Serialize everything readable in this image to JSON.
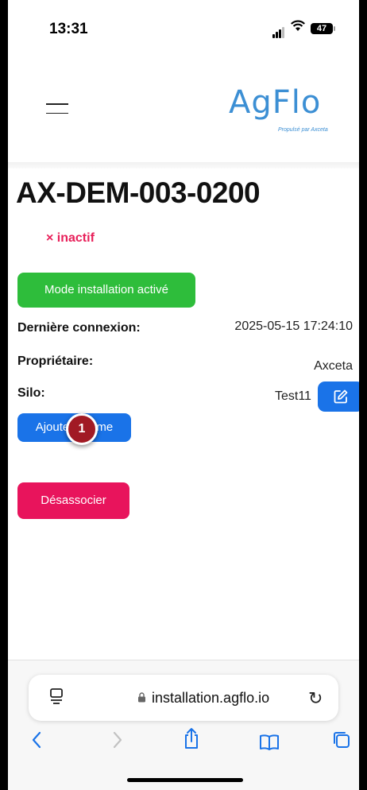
{
  "status_bar": {
    "time": "13:31",
    "battery": "47"
  },
  "header": {
    "logo_text": "AgFlo",
    "logo_subtitle": "Propulsé par Axceta"
  },
  "device": {
    "title": "AX-DEM-003-0200",
    "status": "× inactif",
    "install_mode_button": "Mode installation activé",
    "last_connection_label": "Dernière connexion:",
    "last_connection_value": "2025-05-15 17:24:10",
    "owner_label": "Propriétaire:",
    "owner_value": "Axceta",
    "silo_label": "Silo:",
    "silo_value": "Test11",
    "add_button": "Ajouter alarme",
    "dissociate_button": "Désassocier"
  },
  "marker": {
    "number": "1"
  },
  "browser": {
    "url": "installation.agflo.io"
  },
  "colors": {
    "accent_blue": "#1a73e8",
    "green": "#2ebd3b",
    "pink": "#e8145c",
    "inactive_red": "#e8205a",
    "logo_blue": "#3c8fd4"
  }
}
